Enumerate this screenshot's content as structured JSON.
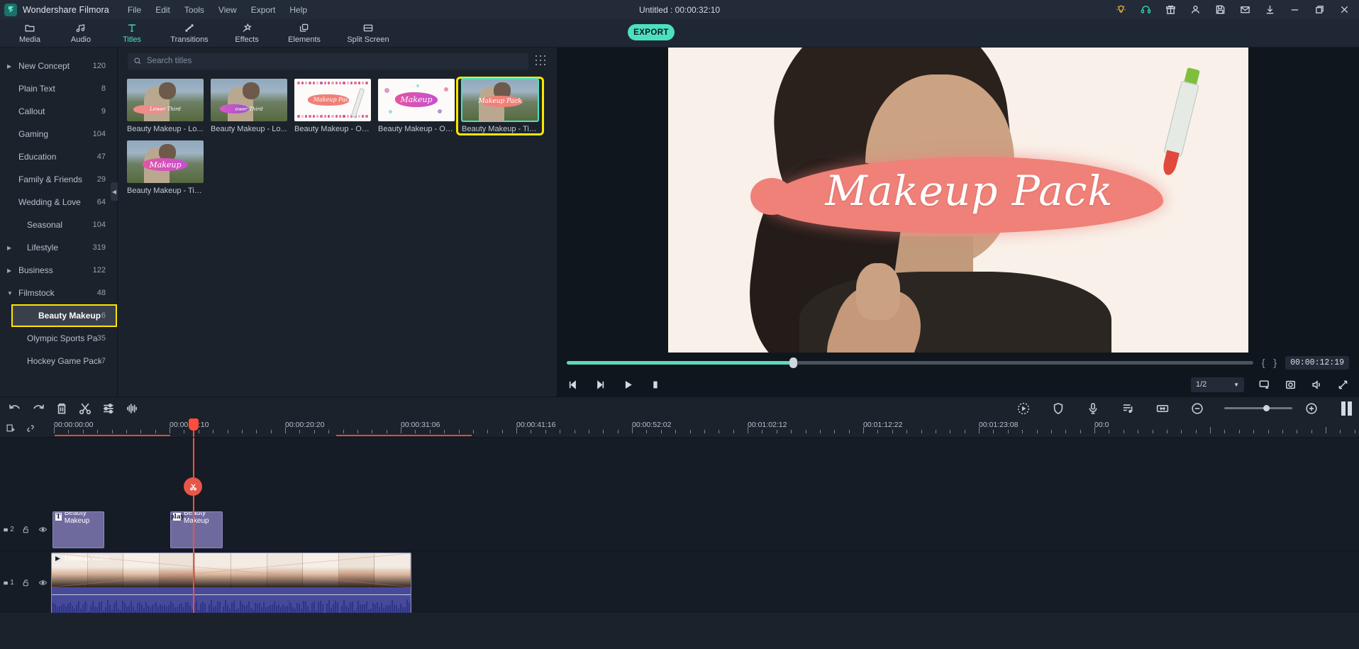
{
  "titlebar": {
    "app_name": "Wondershare Filmora",
    "menus": [
      "File",
      "Edit",
      "Tools",
      "View",
      "Export",
      "Help"
    ],
    "project_title": "Untitled : 00:00:32:10",
    "icons": [
      "lightbulb-icon",
      "headset-icon",
      "gift-icon",
      "account-icon",
      "save-icon",
      "mail-icon",
      "download-icon",
      "minimize-icon",
      "maximize-icon",
      "close-icon"
    ],
    "accent_teal": "#4ce0c0",
    "lightbulb_color": "#f2b33d"
  },
  "tooltabs": {
    "items": [
      {
        "label": "Media",
        "icon": "folder-icon",
        "active": false
      },
      {
        "label": "Audio",
        "icon": "music-note-icon",
        "active": false
      },
      {
        "label": "Titles",
        "icon": "text-t-icon",
        "active": true
      },
      {
        "label": "Transitions",
        "icon": "transition-arrows-icon",
        "active": false
      },
      {
        "label": "Effects",
        "icon": "magic-wand-icon",
        "active": false
      },
      {
        "label": "Elements",
        "icon": "layers-icon",
        "active": false
      },
      {
        "label": "Split Screen",
        "icon": "split-screen-icon",
        "active": false
      }
    ],
    "export_label": "EXPORT"
  },
  "sidebar": {
    "categories": [
      {
        "label": "New Concept",
        "count": "120",
        "expandable": true,
        "expanded": false,
        "sub": false
      },
      {
        "label": "Plain Text",
        "count": "8",
        "expandable": false,
        "expanded": false,
        "sub": false
      },
      {
        "label": "Callout",
        "count": "9",
        "expandable": false,
        "expanded": false,
        "sub": false
      },
      {
        "label": "Gaming",
        "count": "104",
        "expandable": false,
        "expanded": false,
        "sub": false
      },
      {
        "label": "Education",
        "count": "47",
        "expandable": false,
        "expanded": false,
        "sub": false
      },
      {
        "label": "Family & Friends",
        "count": "29",
        "expandable": false,
        "expanded": false,
        "sub": false
      },
      {
        "label": "Wedding & Love",
        "count": "64",
        "expandable": false,
        "expanded": false,
        "sub": false
      },
      {
        "label": "Seasonal",
        "count": "104",
        "expandable": false,
        "expanded": false,
        "sub": true
      },
      {
        "label": "Lifestyle",
        "count": "319",
        "expandable": true,
        "expanded": false,
        "sub": true
      },
      {
        "label": "Business",
        "count": "122",
        "expandable": true,
        "expanded": false,
        "sub": false
      },
      {
        "label": "Filmstock",
        "count": "48",
        "expandable": true,
        "expanded": true,
        "sub": false
      },
      {
        "label": "Beauty Makeup P.",
        "count": "6",
        "expandable": false,
        "expanded": false,
        "sub": true,
        "selected": true,
        "highlighted": true
      },
      {
        "label": "Olympic Sports Pac",
        "count": "35",
        "expandable": false,
        "expanded": false,
        "sub": true
      },
      {
        "label": "Hockey Game Pack",
        "count": "7",
        "expandable": false,
        "expanded": false,
        "sub": true
      }
    ],
    "highlight_color": "#ffe500"
  },
  "library": {
    "search_placeholder": "Search titles",
    "search_value": "",
    "search_icon": "search-icon",
    "grid_toggle_icon": "grid-dots-icon",
    "thumbnails": [
      {
        "caption": "Beauty Makeup - Lo...",
        "art": "field",
        "word": "Lower Third",
        "selected": false
      },
      {
        "caption": "Beauty Makeup - Lo...",
        "art": "field",
        "word": "ower Third",
        "selected": false
      },
      {
        "caption": "Beauty Makeup - Op...",
        "art": "white-dots-bottom",
        "word": "Makeup Pack",
        "selected": false
      },
      {
        "caption": "Beauty Makeup - Op...",
        "art": "white-splash",
        "word": "Makeup",
        "selected": false
      },
      {
        "caption": "Beauty Makeup - Titl...",
        "art": "field-pack",
        "word": "Makeup Pack",
        "selected": true,
        "highlighted": true
      },
      {
        "caption": "Beauty Makeup - Titl...",
        "art": "field-makeup",
        "word": "Makeup",
        "selected": false
      }
    ]
  },
  "preview": {
    "overlay_text": "Makeup Pack",
    "timecode": "00:00:12:19",
    "progress_percent": 33,
    "mark_in_label": "{",
    "mark_out_label": "}",
    "controls": [
      {
        "name": "previous-frame-button",
        "icon": "prev-frame-icon"
      },
      {
        "name": "next-frame-button",
        "icon": "next-frame-icon"
      },
      {
        "name": "play-button",
        "icon": "play-icon"
      },
      {
        "name": "stop-button",
        "icon": "stop-icon"
      }
    ],
    "ratio_value": "1/2",
    "right_controls": [
      {
        "name": "display-settings-button",
        "icon": "monitor-icon"
      },
      {
        "name": "snapshot-button",
        "icon": "camera-icon"
      },
      {
        "name": "volume-button",
        "icon": "speaker-icon"
      },
      {
        "name": "fullscreen-button",
        "icon": "expand-arrows-icon"
      }
    ]
  },
  "timeline": {
    "toolbar_left": [
      {
        "name": "undo-button",
        "icon": "undo-icon"
      },
      {
        "name": "redo-button",
        "icon": "redo-icon"
      },
      {
        "name": "delete-button",
        "icon": "trash-icon"
      },
      {
        "name": "split-button",
        "icon": "scissors-icon"
      },
      {
        "name": "settings-button",
        "icon": "sliders-icon"
      },
      {
        "name": "audio-detach-button",
        "icon": "waveform-icon"
      }
    ],
    "toolbar_right": [
      {
        "name": "record-button",
        "icon": "record-dotted-icon"
      },
      {
        "name": "marker-button",
        "icon": "shield-icon"
      },
      {
        "name": "voiceover-button",
        "icon": "microphone-icon"
      },
      {
        "name": "audio-mixer-button",
        "icon": "audio-mixer-icon"
      },
      {
        "name": "fit-timeline-button",
        "icon": "fit-width-icon"
      },
      {
        "name": "zoom-out-button",
        "icon": "minus-circle-icon"
      },
      {
        "name": "zoom-in-button",
        "icon": "plus-circle-icon"
      },
      {
        "name": "pause-marker",
        "icon": "pause-bars-icon"
      }
    ],
    "zoom_percent": 62,
    "head_icons": [
      {
        "name": "add-track-button",
        "icon": "add-track-icon"
      },
      {
        "name": "link-button",
        "icon": "link-icon"
      }
    ],
    "ruler_labels": [
      "00:00:00:00",
      "00:00:10:10",
      "00:00:20:20",
      "00:00:31:06",
      "00:00:41:16",
      "00:00:52:02",
      "00:01:02:12",
      "00:01:12:22",
      "00:01:23:08",
      "00:0"
    ],
    "playhead_timecode": "00:00:10:10",
    "tracks": [
      {
        "number": "2",
        "lock_icon": "unlock-icon",
        "eye_icon": "eye-icon",
        "clips": [
          {
            "label": "Beauty Makeup",
            "badge": "T",
            "type": "title"
          },
          {
            "label": "Beauty Makeup",
            "badge": "T",
            "type": "title"
          }
        ]
      },
      {
        "number": "1",
        "lock_icon": "unlock-icon",
        "eye_icon": "eye-icon",
        "clips": [
          {
            "label": "Makeup Video",
            "badge": "play",
            "type": "video"
          }
        ]
      }
    ]
  }
}
